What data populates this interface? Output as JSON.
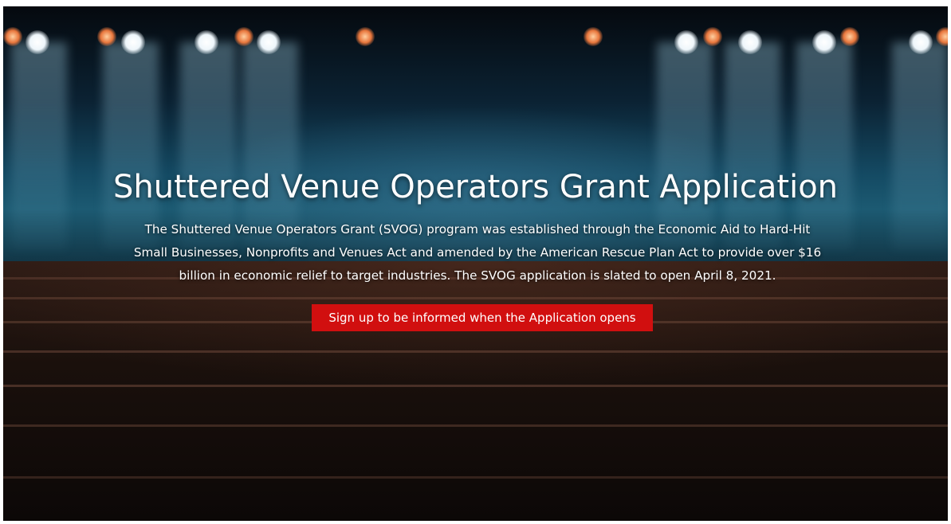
{
  "hero": {
    "title": "Shuttered Venue Operators Grant Application",
    "description": "The Shuttered Venue Operators Grant (SVOG) program was established through the Economic Aid to Hard-Hit Small Businesses, Nonprofits and Venues Act and amended by the American Rescue Plan Act to provide over $16 billion in economic relief to target industries. The SVOG application is slated to open April 8, 2021.",
    "cta_label": "Sign up to be informed when the Application opens",
    "cta_color": "#d10f0f",
    "background_image": "theater-stage-with-spotlights-and-seats"
  }
}
